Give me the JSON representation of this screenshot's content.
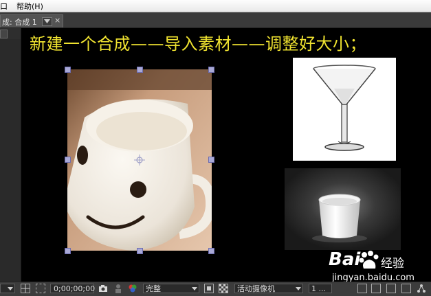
{
  "menubar": {
    "items": [
      "口",
      "帮助(H)"
    ]
  },
  "comp_tab": {
    "label": "成: 合成 1",
    "close": "×"
  },
  "canvas": {
    "title_text": "新建一个合成——导入素材——调整好大小；",
    "text_color": "#f0e330",
    "layers": [
      "smiley-mug-photo",
      "martini-glass-photo",
      "white-cup-photo"
    ]
  },
  "statusbar": {
    "timecode": "0;00;00;00",
    "resolution": "完整",
    "camera": "活动摄像机",
    "views": "1 ..."
  },
  "watermark": {
    "brand": "Bai",
    "brand_suffix": "经验",
    "url": "jingyan.baidu.com"
  },
  "colors": {
    "menubar_bg": "#f0f0f0",
    "panel_bg": "#3a3a3a",
    "canvas_bg": "#000000",
    "handle": "#a9a9d6"
  }
}
